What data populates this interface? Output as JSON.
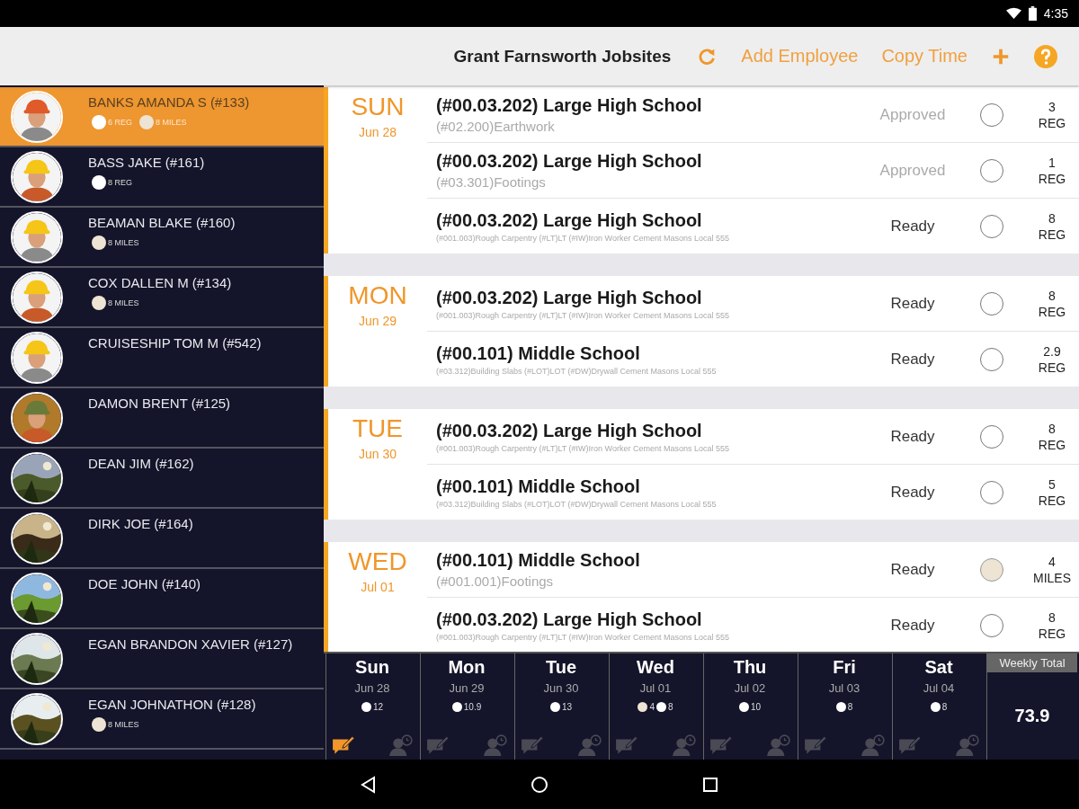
{
  "status_bar": {
    "time": "4:35"
  },
  "toolbar": {
    "title": "Grant Farnsworth Jobsites",
    "actions": [
      "Add Employee",
      "Copy Time"
    ]
  },
  "employees": [
    {
      "name": "BANKS AMANDA S (#133)",
      "selected": true,
      "chips": [
        {
          "label": "6 REG",
          "color": "#ffffff"
        },
        {
          "label": "8 MILES",
          "color": "#ede4d3"
        }
      ]
    },
    {
      "name": "BASS JAKE  (#161)",
      "selected": false,
      "chips": [
        {
          "label": "8 REG",
          "color": "#ffffff"
        }
      ]
    },
    {
      "name": "BEAMAN BLAKE  (#160)",
      "selected": false,
      "chips": [
        {
          "label": "8 MILES",
          "color": "#ede4d3"
        }
      ]
    },
    {
      "name": "COX DALLEN M (#134)",
      "selected": false,
      "chips": [
        {
          "label": "8 MILES",
          "color": "#ede4d3"
        }
      ]
    },
    {
      "name": "CRUISESHIP TOM M (#542)",
      "selected": false
    },
    {
      "name": "DAMON BRENT  (#125)",
      "selected": false
    },
    {
      "name": "DEAN JIM  (#162)",
      "selected": false
    },
    {
      "name": "DIRK JOE  (#164)",
      "selected": false
    },
    {
      "name": "DOE JOHN  (#140)",
      "selected": false
    },
    {
      "name": "EGAN BRANDON XAVIER (#127)",
      "selected": false
    },
    {
      "name": "EGAN JOHNATHON  (#128)",
      "selected": false,
      "chips": [
        {
          "label": "8 MILES",
          "color": "#ede4d3"
        }
      ]
    }
  ],
  "days": [
    {
      "day": "SUN",
      "date": "Jun 28",
      "entries": [
        {
          "job": "(#00.03.202) Large High School",
          "detail": "(#02.200)Earthwork",
          "status": "Approved",
          "approved": true,
          "filled": false,
          "qty": "3",
          "unit": "REG"
        },
        {
          "job": "(#00.03.202) Large High School",
          "detail": "(#03.301)Footings",
          "status": "Approved",
          "approved": true,
          "filled": false,
          "qty": "1",
          "unit": "REG"
        },
        {
          "job": "(#00.03.202) Large High School",
          "detail": "(#001.003)Rough Carpentry (#LT)LT (#IW)Iron Worker Cement Masons Local 555",
          "status": "Ready",
          "approved": false,
          "filled": false,
          "qty": "8",
          "unit": "REG"
        }
      ]
    },
    {
      "day": "MON",
      "date": "Jun 29",
      "entries": [
        {
          "job": "(#00.03.202) Large High School",
          "detail": "(#001.003)Rough Carpentry (#LT)LT (#IW)Iron Worker Cement Masons Local 555",
          "status": "Ready",
          "approved": false,
          "filled": false,
          "qty": "8",
          "unit": "REG"
        },
        {
          "job": "(#00.101) Middle School",
          "detail": "(#03.312)Building Slabs (#LOT)LOT (#DW)Drywall Cement Masons Local 555",
          "status": "Ready",
          "approved": false,
          "filled": false,
          "qty": "2.9",
          "unit": "REG"
        }
      ]
    },
    {
      "day": "TUE",
      "date": "Jun 30",
      "entries": [
        {
          "job": "(#00.03.202) Large High School",
          "detail": "(#001.003)Rough Carpentry (#LT)LT (#IW)Iron Worker Cement Masons Local 555",
          "status": "Ready",
          "approved": false,
          "filled": false,
          "qty": "8",
          "unit": "REG"
        },
        {
          "job": "(#00.101) Middle School",
          "detail": "(#03.312)Building Slabs (#LOT)LOT (#DW)Drywall Cement Masons Local 555",
          "status": "Ready",
          "approved": false,
          "filled": false,
          "qty": "5",
          "unit": "REG"
        }
      ]
    },
    {
      "day": "WED",
      "date": "Jul 01",
      "entries": [
        {
          "job": "(#00.101) Middle School",
          "detail": "(#001.001)Footings",
          "status": "Ready",
          "approved": false,
          "filled": true,
          "qty": "4",
          "unit": "MILES"
        },
        {
          "job": "(#00.03.202) Large High School",
          "detail": "(#001.003)Rough Carpentry (#LT)LT (#IW)Iron Worker Cement Masons Local 555",
          "status": "Ready",
          "approved": false,
          "filled": false,
          "qty": "8",
          "unit": "REG"
        }
      ]
    }
  ],
  "summary": {
    "days": [
      {
        "day": "Sun",
        "date": "Jun 28",
        "note_active": true,
        "chips": [
          {
            "value": "12",
            "color": "#ffffff"
          }
        ]
      },
      {
        "day": "Mon",
        "date": "Jun 29",
        "note_active": false,
        "chips": [
          {
            "value": "10.9",
            "color": "#ffffff"
          }
        ]
      },
      {
        "day": "Tue",
        "date": "Jun 30",
        "note_active": false,
        "chips": [
          {
            "value": "13",
            "color": "#ffffff"
          }
        ]
      },
      {
        "day": "Wed",
        "date": "Jul 01",
        "note_active": false,
        "chips": [
          {
            "value": "4",
            "color": "#ede4d3"
          },
          {
            "value": "8",
            "color": "#ffffff"
          }
        ]
      },
      {
        "day": "Thu",
        "date": "Jul 02",
        "note_active": false,
        "chips": [
          {
            "value": "10",
            "color": "#ffffff"
          }
        ]
      },
      {
        "day": "Fri",
        "date": "Jul 03",
        "note_active": false,
        "chips": [
          {
            "value": "8",
            "color": "#ffffff"
          }
        ]
      },
      {
        "day": "Sat",
        "date": "Jul 04",
        "note_active": false,
        "chips": [
          {
            "value": "8",
            "color": "#ffffff"
          }
        ]
      }
    ],
    "total_label": "Weekly Total",
    "total": "73.9"
  }
}
